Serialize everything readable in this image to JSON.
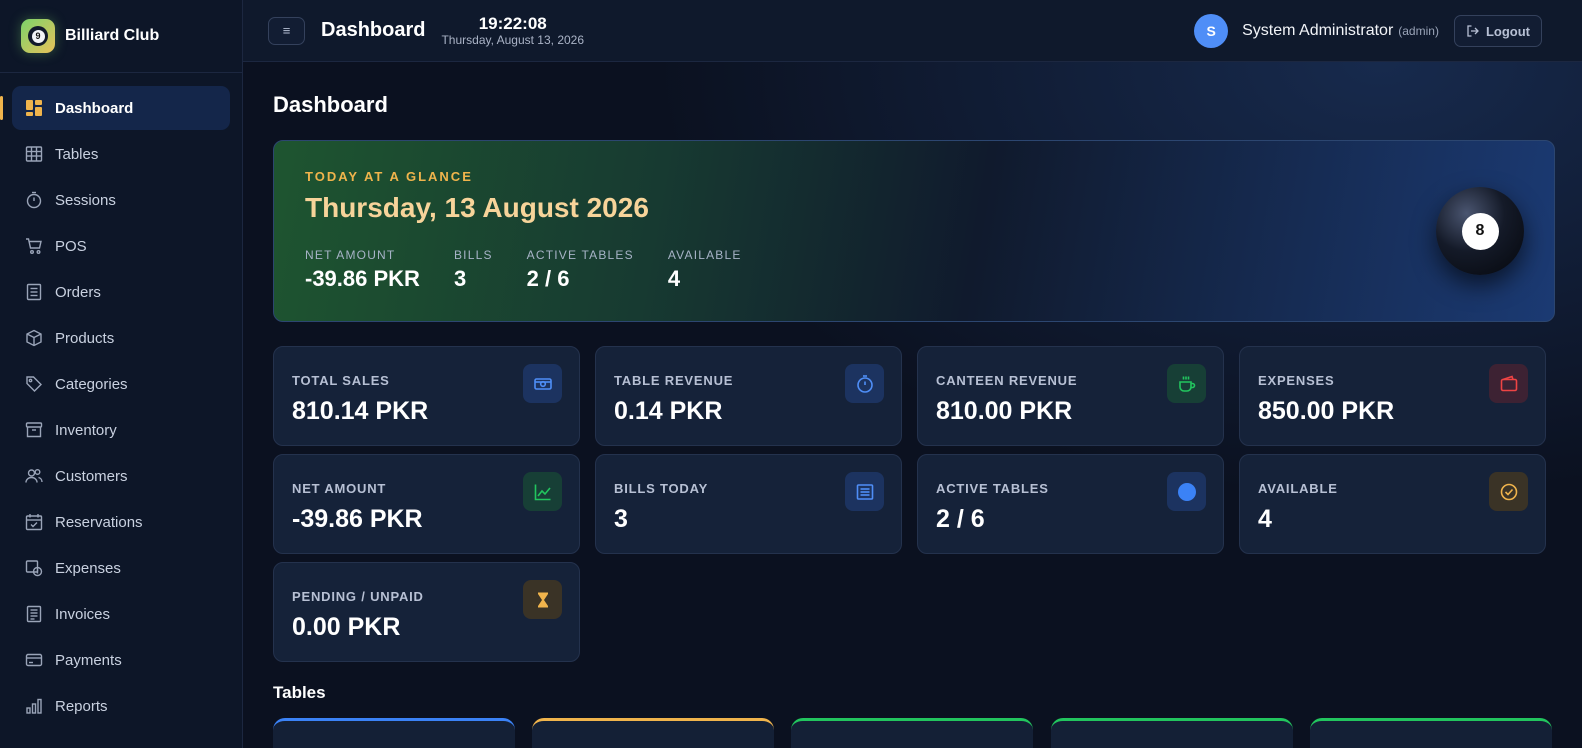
{
  "brand": {
    "name": "Billiard Club",
    "logo_ball": "9"
  },
  "sidebar": {
    "items": [
      {
        "label": "Dashboard",
        "icon": "dashboard-icon",
        "active": true
      },
      {
        "label": "Tables",
        "icon": "table-grid-icon"
      },
      {
        "label": "Sessions",
        "icon": "stopwatch-icon"
      },
      {
        "label": "POS",
        "icon": "cart-icon"
      },
      {
        "label": "Orders",
        "icon": "receipt-icon"
      },
      {
        "label": "Products",
        "icon": "box-icon"
      },
      {
        "label": "Categories",
        "icon": "tags-icon"
      },
      {
        "label": "Inventory",
        "icon": "archive-icon"
      },
      {
        "label": "Customers",
        "icon": "users-icon"
      },
      {
        "label": "Reservations",
        "icon": "calendar-check-icon"
      },
      {
        "label": "Expenses",
        "icon": "expenses-icon"
      },
      {
        "label": "Invoices",
        "icon": "invoice-icon"
      },
      {
        "label": "Payments",
        "icon": "credit-card-icon"
      },
      {
        "label": "Reports",
        "icon": "bar-chart-icon"
      }
    ]
  },
  "topbar": {
    "menu_glyph": "≡",
    "title": "Dashboard",
    "time": "19:22:08",
    "date": "Thursday, August 13, 2026",
    "user_initial": "S",
    "user_name": "System Administrator",
    "user_role": "(admin)",
    "logout_label": "Logout"
  },
  "page": {
    "title": "Dashboard"
  },
  "hero": {
    "kicker": "TODAY AT A GLANCE",
    "date": "Thursday, 13 August 2026",
    "ball_number": "8",
    "stats": [
      {
        "label": "NET AMOUNT",
        "value": "-39.86 PKR"
      },
      {
        "label": "BILLS",
        "value": "3"
      },
      {
        "label": "ACTIVE TABLES",
        "value": "2 / 6"
      },
      {
        "label": "AVAILABLE",
        "value": "4"
      }
    ]
  },
  "cards": [
    {
      "label": "TOTAL SALES",
      "value": "810.14 PKR",
      "icon": "cash-icon",
      "color": "#3b82f6"
    },
    {
      "label": "TABLE REVENUE",
      "value": "0.14 PKR",
      "icon": "stopwatch-icon",
      "color": "#3b82f6"
    },
    {
      "label": "CANTEEN REVENUE",
      "value": "810.00 PKR",
      "icon": "coffee-cup-icon",
      "color": "#22c55e"
    },
    {
      "label": "EXPENSES",
      "value": "850.00 PKR",
      "icon": "wallet-icon",
      "color": "#ef4444"
    },
    {
      "label": "NET AMOUNT",
      "value": "-39.86 PKR",
      "icon": "trend-up-icon",
      "color": "#22c55e"
    },
    {
      "label": "BILLS TODAY",
      "value": "3",
      "icon": "receipt-icon",
      "color": "#3b82f6"
    },
    {
      "label": "ACTIVE TABLES",
      "value": "2 / 6",
      "icon": "dot-icon",
      "color": "#3b82f6"
    },
    {
      "label": "AVAILABLE",
      "value": "4",
      "icon": "check-circle-icon",
      "color": "#f0b44c"
    },
    {
      "label": "PENDING / UNPAID",
      "value": "0.00 PKR",
      "icon": "hourglass-icon",
      "color": "#f0b44c"
    }
  ],
  "tables_section": {
    "title": "Tables",
    "tile_colors": [
      "#3b82f6",
      "#f0b44c",
      "#22c55e",
      "#22c55e",
      "#22c55e"
    ]
  }
}
